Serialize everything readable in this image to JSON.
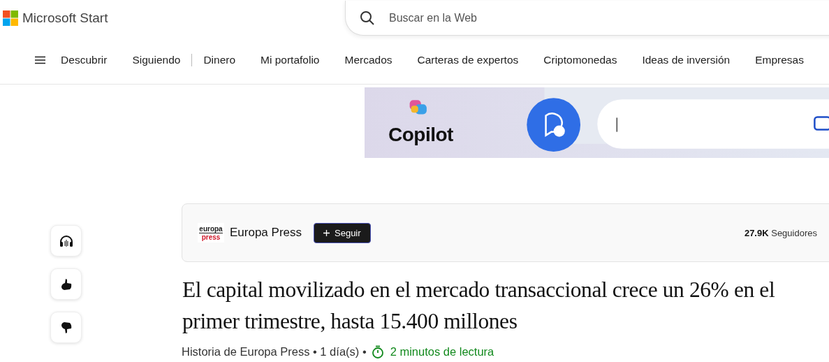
{
  "header": {
    "logo": "Microsoft Start",
    "search": {
      "placeholder": "Buscar en la Web"
    }
  },
  "nav": {
    "items": [
      {
        "label": "Descubrir",
        "divider_after": false
      },
      {
        "label": "Siguiendo",
        "divider_after": true
      },
      {
        "label": "Dinero",
        "divider_after": false
      },
      {
        "label": "Mi portafolio",
        "divider_after": false
      },
      {
        "label": "Mercados",
        "divider_after": false
      },
      {
        "label": "Carteras de expertos",
        "divider_after": false
      },
      {
        "label": "Criptomonedas",
        "divider_after": false
      },
      {
        "label": "Ideas de inversión",
        "divider_after": false
      },
      {
        "label": "Empresas",
        "divider_after": false
      }
    ]
  },
  "banner": {
    "kind": "picture",
    "brand": "Copilot"
  },
  "side_actions": [
    {
      "kind": "listen"
    },
    {
      "kind": "like"
    },
    {
      "kind": "dislike"
    }
  ],
  "publisher": {
    "logo_top": "europa",
    "logo_bottom": "press",
    "name": "Europa Press",
    "follow": "Seguir",
    "followers": "**27.9K** Seguidores"
  },
  "article": {
    "title": "El capital movilizado en el mercado transaccional crece un 26% en el primer trimestre, hasta 15.400 millones",
    "byline": "Historia de Europa Press • 1 día(s) •",
    "read_time": "2 minutos de lectura"
  }
}
